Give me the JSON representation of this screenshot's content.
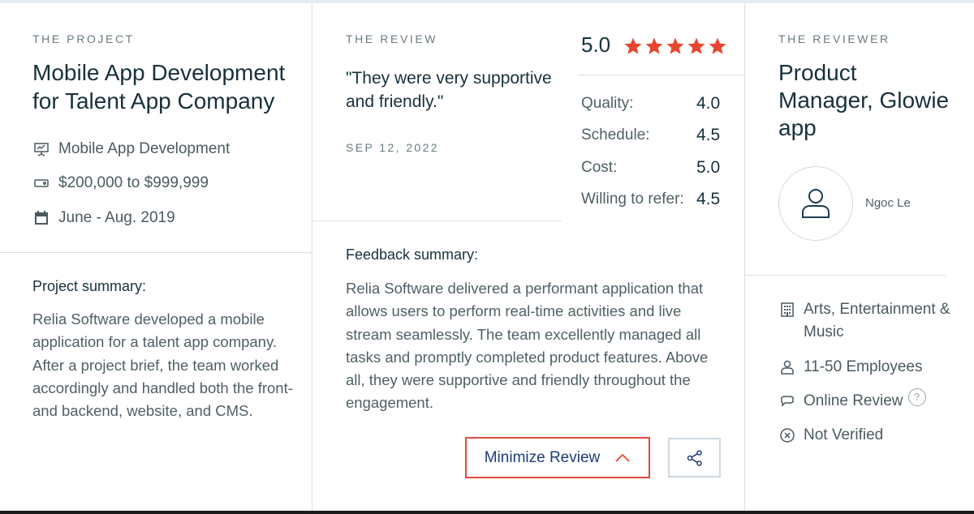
{
  "project": {
    "eyebrow": "THE PROJECT",
    "title": "Mobile App Development for Talent App Company",
    "service": "Mobile App Development",
    "budget": "$200,000 to $999,999",
    "dates": "June - Aug. 2019",
    "summary_heading": "Project summary:",
    "summary_text": "Relia Software developed a mobile application for a talent app company. After a project brief, the team worked accordingly and handled both the front- and backend, website, and CMS."
  },
  "review": {
    "eyebrow": "THE REVIEW",
    "quote": "\"They were very supportive and friendly.\"",
    "date": "SEP 12, 2022",
    "overall_rating": "5.0",
    "stars": 5,
    "star_color": "#e8452f",
    "scores": [
      {
        "label": "Quality:",
        "value": "4.0"
      },
      {
        "label": "Schedule:",
        "value": "4.5"
      },
      {
        "label": "Cost:",
        "value": "5.0"
      },
      {
        "label": "Willing to refer:",
        "value": "4.5"
      }
    ],
    "feedback_heading": "Feedback summary:",
    "feedback_text": "Relia Software delivered a performant application that allows users to perform real-time activities and live stream seamlessly. The team excellently managed all tasks and promptly completed product features. Above all, they were supportive and friendly throughout the engagement.",
    "minimize_label": "Minimize Review",
    "accent_color": "#e04b3a"
  },
  "reviewer": {
    "eyebrow": "THE REVIEWER",
    "title": "Product Manager, Glowie app",
    "name": "Ngoc Le",
    "industry": "Arts, Entertainment & Music",
    "size": "11-50 Employees",
    "review_type": "Online Review",
    "help_glyph": "?",
    "verification": "Not Verified"
  }
}
